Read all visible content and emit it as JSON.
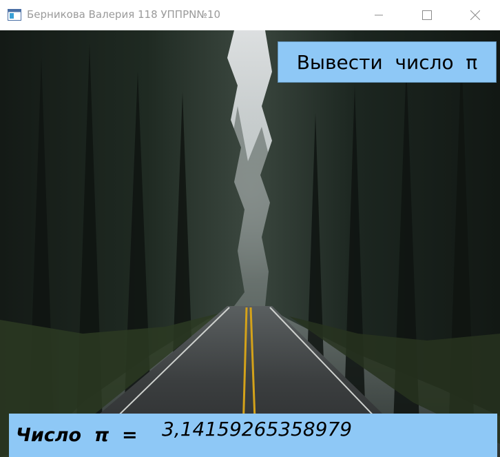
{
  "window": {
    "title": "Берникова Валерия 118 УППРN№10",
    "icon": "app-window-icon",
    "controls": [
      "minimize-icon",
      "maximize-icon",
      "close-icon"
    ]
  },
  "background": {
    "type": "photo",
    "subject": "wet asphalt road with yellow center lines through a dark misty pine forest"
  },
  "actions": {
    "show_pi_label": "Вывести  число  π"
  },
  "result": {
    "label": "Число  π  =",
    "value": "3,14159265358979"
  },
  "colors": {
    "button_bg": "#8ec8f6",
    "result_bg": "#8ec8f6",
    "title_text": "#9a9a9a"
  }
}
